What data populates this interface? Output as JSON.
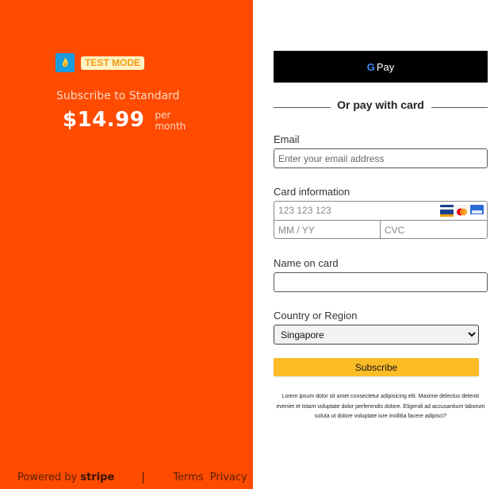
{
  "summary": {
    "badge": "TEST MODE",
    "subscribe_label": "Subscribe to Standard",
    "price": "$14.99",
    "per": "per",
    "period": "month"
  },
  "footer": {
    "powered_by": "Powered by",
    "stripe": "stripe",
    "terms": "Terms",
    "privacy": "Privacy"
  },
  "payment": {
    "gpay_g": "G",
    "gpay_label": "Pay",
    "divider": "Or pay with card"
  },
  "form": {
    "email_label": "Email",
    "email_placeholder": "Enter your email address",
    "card_label": "Card information",
    "card_placeholder": "123 123 123",
    "expiry_placeholder": "MM / YY",
    "cvc_placeholder": "CVC",
    "name_label": "Name on card",
    "country_label": "Country or Region",
    "country_selected": "Singapore",
    "submit": "Subscribe",
    "disclaimer": "Lorem ipsum dolor sit amet consectetur adipisicing elit. Maxime delectus deleniti eveniet et totam voluptate dolor perferendis dolore. Eligendi ad accusantium laborum soluta ut dolore voluptate iure mollitia facere adipisci?"
  },
  "colors": {
    "brand_bg": "#ff4b00",
    "button": "#fcbc26",
    "gpay_bg": "#000000"
  }
}
